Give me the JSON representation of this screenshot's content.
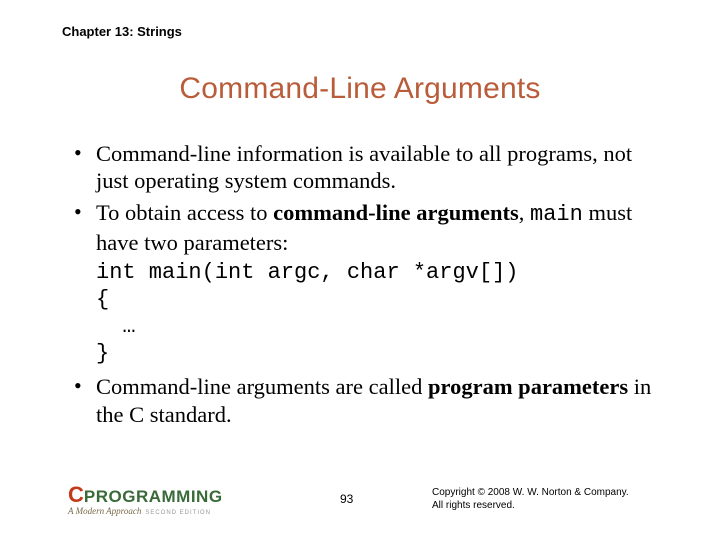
{
  "chapter": "Chapter 13: Strings",
  "title": "Command-Line Arguments",
  "bullets": {
    "b1": "Command-line information is available to all programs, not just operating system commands.",
    "b2_pre": "To obtain access to ",
    "b2_bold": "command-line arguments",
    "b2_post1": ", ",
    "b2_mono": "main",
    "b2_post2": " must have two parameters:",
    "code": "int main(int argc, char *argv[])\n{\n  …\n}",
    "b3_pre": "Command-line arguments are called ",
    "b3_bold": "program parameters",
    "b3_post": " in the C standard."
  },
  "logo": {
    "c": "C",
    "prog": "PROGRAMMING",
    "sub": "A Modern Approach",
    "ed": "SECOND EDITION"
  },
  "page": "93",
  "copyright": {
    "line1": "Copyright © 2008 W. W. Norton & Company.",
    "line2": "All rights reserved."
  }
}
